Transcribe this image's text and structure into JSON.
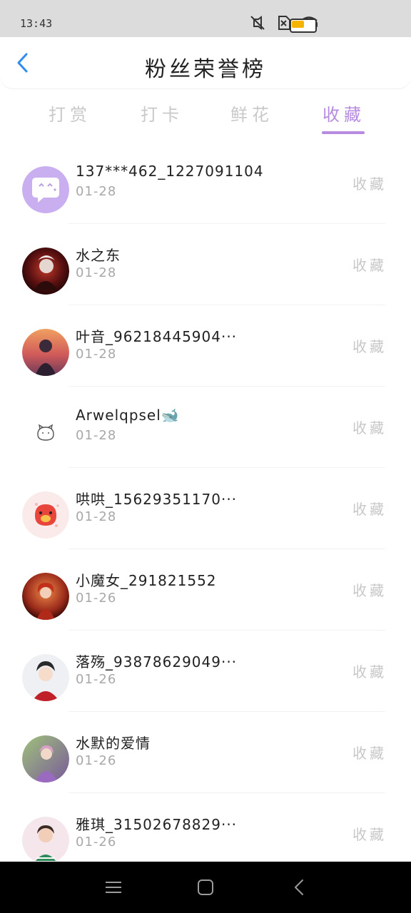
{
  "status_bar": {
    "time": "13:43",
    "icons": [
      "mute-icon",
      "no-sim-icon",
      "wifi-icon",
      "battery-icon"
    ],
    "battery_fill_fraction": 0.55,
    "colors": {
      "background": "#dcdcdc",
      "battery": "#f4b400"
    }
  },
  "header": {
    "title": "粉丝荣誉榜",
    "back_icon": "chevron-left-icon",
    "accent_color": "#2f8cf0"
  },
  "tabs": [
    {
      "label": "打赏",
      "active": false
    },
    {
      "label": "打卡",
      "active": false
    },
    {
      "label": "鲜花",
      "active": false
    },
    {
      "label": "收藏",
      "active": true
    }
  ],
  "tab_active_color": "#b78ce0",
  "rows": [
    {
      "name": "137***462_1227091104",
      "date": "01-28",
      "action": "收藏",
      "avatar": "default-chat-avatar"
    },
    {
      "name": "水之东",
      "date": "01-28",
      "action": "收藏",
      "avatar": "dark-warrior-avatar"
    },
    {
      "name": "叶音_96218445904···",
      "date": "01-28",
      "action": "收藏",
      "avatar": "sunset-girl-avatar"
    },
    {
      "name": "Arwelqpsel🐋",
      "date": "01-28",
      "action": "收藏",
      "avatar": "cat-sketch-avatar"
    },
    {
      "name": "哄哄_15629351170···",
      "date": "01-28",
      "action": "收藏",
      "avatar": "red-pig-avatar"
    },
    {
      "name": "小魔女_291821552",
      "date": "01-26",
      "action": "收藏",
      "avatar": "red-hair-girl-avatar"
    },
    {
      "name": "落殇_93878629049···",
      "date": "01-26",
      "action": "收藏",
      "avatar": "costume-lady-avatar"
    },
    {
      "name": "水默的爱情",
      "date": "01-26",
      "action": "收藏",
      "avatar": "purple-fairy-avatar"
    },
    {
      "name": "雅琪_31502678829···",
      "date": "01-26",
      "action": "收藏",
      "avatar": "portrait-girl-avatar"
    }
  ],
  "nav_bar": {
    "buttons": [
      "menu-icon",
      "home-icon",
      "back-icon"
    ]
  }
}
